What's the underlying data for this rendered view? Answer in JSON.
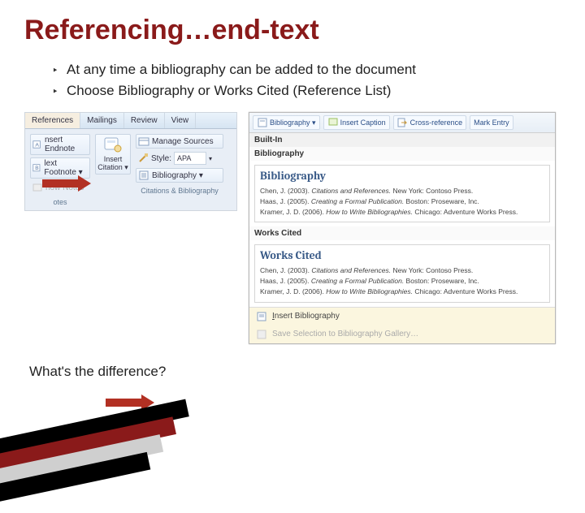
{
  "title": "Referencing…end-text",
  "bullets": {
    "marker": "‣",
    "items": [
      "At any time a bibliography can be added to the document",
      "Choose Bibliography or Works Cited (Reference List)"
    ]
  },
  "question": "What's the difference?",
  "ribbon": {
    "tabs": [
      "References",
      "Mailings",
      "Review",
      "View"
    ],
    "activeTab": "References",
    "col1": [
      "nsert Endnote",
      "lext Footnote ▾",
      "how Notes"
    ],
    "col1Label": "otes",
    "bigButton": "Insert Citation ▾",
    "col3": {
      "manage": "Manage Sources",
      "styleLabel": "Style:",
      "styleValue": "APA",
      "biblio": "Bibliography ▾"
    },
    "groupLabel": "Citations & Bibliography"
  },
  "dropdown": {
    "top": {
      "biblio": "Bibliography ▾",
      "caption": "Insert Caption",
      "cross": "Cross-reference",
      "mark": "Mark Entry"
    },
    "builtInLabel": "Built-In",
    "cards": [
      {
        "heading": "Bibliography",
        "title": "Bibliography",
        "refs": [
          {
            "a": "Chen, J. (2003). ",
            "t": "Citations and References.",
            "p": " New York: Contoso Press."
          },
          {
            "a": "Haas, J. (2005). ",
            "t": "Creating a Formal Publication.",
            "p": " Boston: Proseware, Inc."
          },
          {
            "a": "Kramer, J. D. (2006). ",
            "t": "How to Write Bibliographies.",
            "p": " Chicago: Adventure Works Press."
          }
        ]
      },
      {
        "heading": "Works Cited",
        "title": "Works Cited",
        "refs": [
          {
            "a": "Chen, J. (2003). ",
            "t": "Citations and References.",
            "p": " New York: Contoso Press."
          },
          {
            "a": "Haas, J. (2005). ",
            "t": "Creating a Formal Publication.",
            "p": " Boston: Proseware, Inc."
          },
          {
            "a": "Kramer, J. D. (2006). ",
            "t": "How to Write Bibliographies.",
            "p": " Chicago: Adventure Works Press."
          }
        ]
      }
    ],
    "footer": {
      "insert": "Insert Bibliography",
      "save": "Save Selection to Bibliography Gallery…"
    }
  }
}
